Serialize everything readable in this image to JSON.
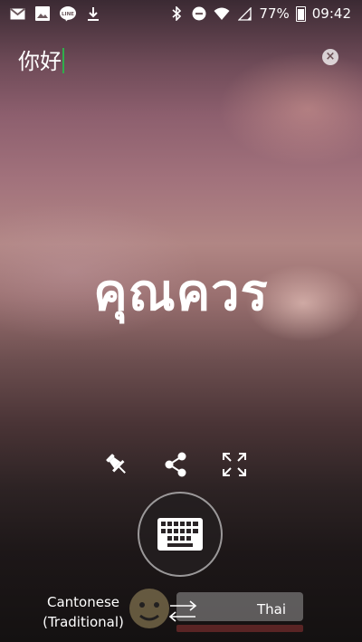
{
  "status_bar": {
    "left_icons": [
      "gmail-icon",
      "gallery-icon",
      "line-icon",
      "download-icon"
    ],
    "line_label": "LINE",
    "right_icons": [
      "bluetooth-icon",
      "do-not-disturb-icon",
      "wifi-icon",
      "signal-icon",
      "battery-icon"
    ],
    "battery": "77%",
    "time": "09:42"
  },
  "input": {
    "text": "你好"
  },
  "translation": {
    "text": "คุณควร"
  },
  "actions": [
    "pin-icon",
    "share-icon",
    "fullscreen-icon"
  ],
  "keyboard_button": "keyboard-icon",
  "languages": {
    "source_line1": "Cantonese",
    "source_line2": "(Traditional)",
    "target": "Thai"
  },
  "colors": {
    "caret": "#2fae4b"
  }
}
